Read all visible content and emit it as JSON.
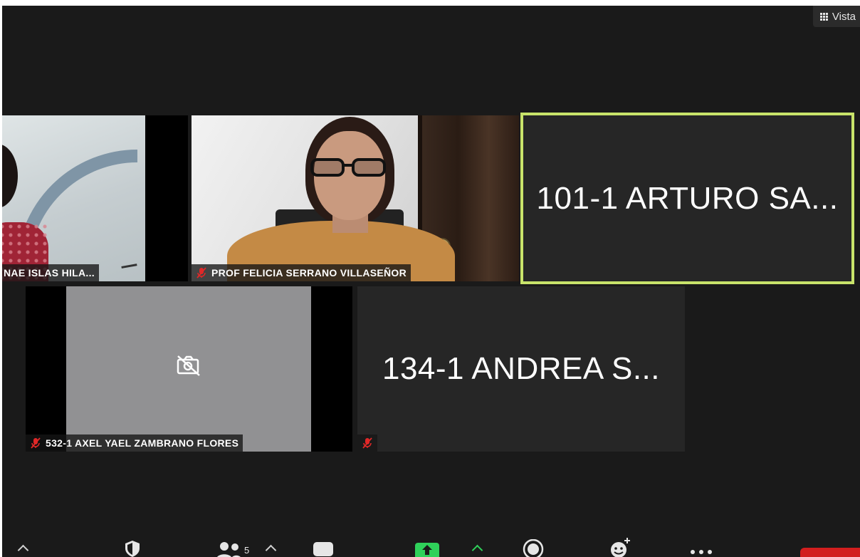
{
  "header": {
    "view_label": "Vista",
    "view_icon": "grid-icon"
  },
  "participants": [
    {
      "name": "NAE ISLAS HILA...",
      "muted": false,
      "video": true
    },
    {
      "name": "PROF FELICIA SERRANO VILLASEÑOR",
      "muted": true,
      "video": true
    },
    {
      "name": "101-1 ARTURO SA...",
      "muted": false,
      "video": false,
      "active_speaker": true
    },
    {
      "name": "532-1 AXEL YAEL ZAMBRANO FLORES",
      "muted": true,
      "video": false
    },
    {
      "name": "134-1 ANDREA S...",
      "muted": true,
      "video": false
    }
  ],
  "toolbar": {
    "participants_count": "5",
    "items": [
      "audio-chevron",
      "security-icon",
      "participants-icon",
      "chat-icon",
      "share-screen-icon",
      "record-icon",
      "reactions-icon",
      "more-icon",
      "end-button"
    ]
  },
  "colors": {
    "background": "#1a1a1a",
    "tile_dark": "#262626",
    "active_speaker_border": "#c8e36a",
    "muted_icon": "#e02828",
    "share_green": "#2fd15a",
    "end_red": "#d21e1e"
  }
}
